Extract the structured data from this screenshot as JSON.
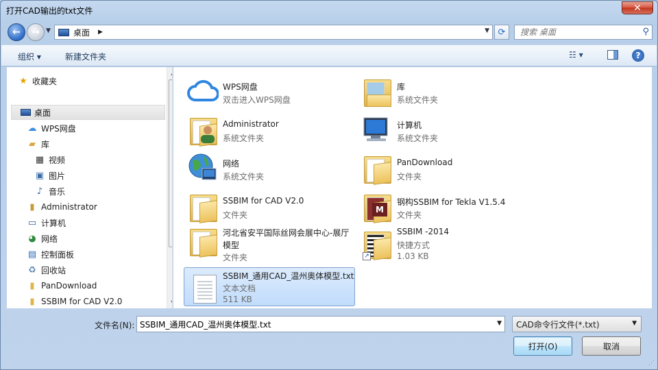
{
  "window": {
    "title": "打开CAD输出的txt文件"
  },
  "address": {
    "location": "桌面",
    "search_placeholder": "搜索 桌面"
  },
  "toolbar": {
    "organize": "组织 ▾",
    "new_folder": "新建文件夹"
  },
  "navpane": {
    "items": [
      {
        "label": "收藏夹",
        "icon": "star-icon"
      },
      {
        "label": "桌面",
        "icon": "desktop-icon"
      },
      {
        "label": "WPS网盘",
        "icon": "cloud-icon"
      },
      {
        "label": "库",
        "icon": "library-icon"
      },
      {
        "label": "视频",
        "icon": "video-icon"
      },
      {
        "label": "图片",
        "icon": "picture-icon"
      },
      {
        "label": "音乐",
        "icon": "music-icon"
      },
      {
        "label": "Administrator",
        "icon": "user-folder-icon"
      },
      {
        "label": "计算机",
        "icon": "computer-icon"
      },
      {
        "label": "网络",
        "icon": "network-icon"
      },
      {
        "label": "控制面板",
        "icon": "control-panel-icon"
      },
      {
        "label": "回收站",
        "icon": "recycle-bin-icon"
      },
      {
        "label": "PanDownload",
        "icon": "folder-icon"
      },
      {
        "label": "SSBIM for CAD V2.0",
        "icon": "folder-icon"
      }
    ]
  },
  "files": [
    {
      "name": "WPS网盘",
      "sub": "双击进入WPS网盘",
      "icon": "cloud-icon"
    },
    {
      "name": "库",
      "sub": "系统文件夹",
      "icon": "library-icon"
    },
    {
      "name": "Administrator",
      "sub": "系统文件夹",
      "icon": "user-folder-icon"
    },
    {
      "name": "计算机",
      "sub": "系统文件夹",
      "icon": "computer-icon"
    },
    {
      "name": "网络",
      "sub": "系统文件夹",
      "icon": "network-icon"
    },
    {
      "name": "PanDownload",
      "sub": "文件夹",
      "icon": "folder-icon"
    },
    {
      "name": "SSBIM for CAD V2.0",
      "sub": "文件夹",
      "icon": "folder-icon"
    },
    {
      "name": "钢构SSBIM for Tekla V1.5.4",
      "sub": "文件夹",
      "icon": "folder-icon"
    },
    {
      "name": "河北省安平国际丝网会展中心-展厅",
      "name2": "模型",
      "sub": "文件夹",
      "icon": "folder-icon"
    },
    {
      "name": "SSBIM -2014",
      "sub": "快捷方式",
      "sub2": "1.03 KB",
      "icon": "shortcut-icon"
    },
    {
      "name": "SSBIM_通用CAD_温州奥体模型.txt",
      "sub": "文本文档",
      "sub2": "511 KB",
      "icon": "text-file-icon"
    }
  ],
  "bottom": {
    "filename_label": "文件名(N):",
    "filename_value": "SSBIM_通用CAD_温州奥体模型.txt",
    "filetype": "CAD命令行文件(*.txt)",
    "open_button": "打开(O)",
    "cancel_button": "取消"
  }
}
